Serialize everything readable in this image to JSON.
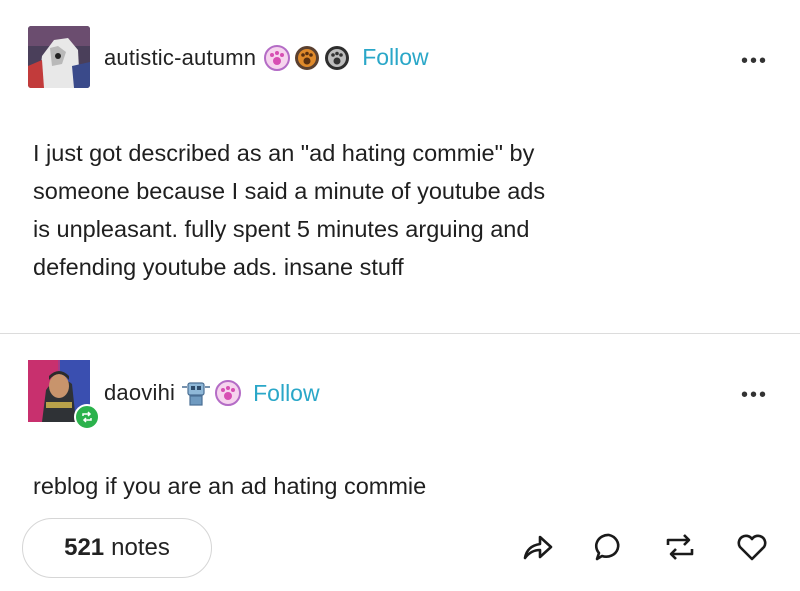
{
  "post1": {
    "username": "autistic-autumn",
    "follow_label": "Follow",
    "more_label": "•••",
    "badges": [
      "paw-badge-pink",
      "paw-badge-orange",
      "paw-badge-gray"
    ],
    "text_lines": [
      "I just got described as an \"ad hating commie\" by",
      "someone because I said a minute of youtube ads",
      "is unpleasant. fully spent 5 minutes arguing and",
      "defending youtube ads. insane stuff"
    ]
  },
  "post2": {
    "username": "daovihi",
    "follow_label": "Follow",
    "more_label": "•••",
    "badges": [
      "robot-badge",
      "paw-badge-pink"
    ],
    "text": "reblog if you are an ad hating commie"
  },
  "footer": {
    "notes_count": "521",
    "notes_word": "notes",
    "actions": [
      "share-icon",
      "reply-icon",
      "reblog-icon",
      "like-icon"
    ]
  },
  "colors": {
    "follow": "#2aa7c8",
    "reblog_badge": "#2bb24c"
  }
}
